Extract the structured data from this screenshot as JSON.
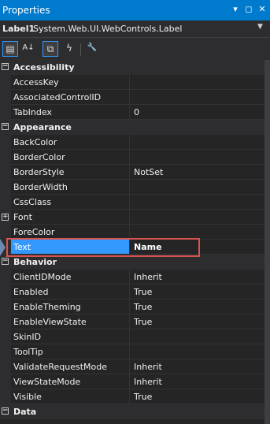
{
  "window": {
    "title": "Properties",
    "buttons": [
      "▾",
      "◻",
      "✕"
    ]
  },
  "object_selector": {
    "name": "Label1",
    "type": "System.Web.UI.WebControls.Label",
    "dropdown": "▼"
  },
  "toolbar": {
    "icons": [
      "categorized-icon",
      "alphabetical-icon",
      "properties-icon",
      "events-icon",
      "property-pages-icon"
    ],
    "glyphs": [
      "▤",
      "A↓",
      "⧉",
      "ϟ",
      "🔧"
    ]
  },
  "categories": [
    {
      "name": "Accessibility",
      "properties": [
        {
          "name": "AccessKey",
          "value": ""
        },
        {
          "name": "AssociatedControlID",
          "value": ""
        },
        {
          "name": "TabIndex",
          "value": "0"
        }
      ]
    },
    {
      "name": "Appearance",
      "properties": [
        {
          "name": "BackColor",
          "value": ""
        },
        {
          "name": "BorderColor",
          "value": ""
        },
        {
          "name": "BorderStyle",
          "value": "NotSet"
        },
        {
          "name": "BorderWidth",
          "value": ""
        },
        {
          "name": "CssClass",
          "value": ""
        },
        {
          "name": "Font",
          "value": ""
        },
        {
          "name": "ForeColor",
          "value": ""
        },
        {
          "name": "Text",
          "value": "Name"
        }
      ]
    },
    {
      "name": "Behavior",
      "properties": [
        {
          "name": "ClientIDMode",
          "value": "Inherit"
        },
        {
          "name": "Enabled",
          "value": "True"
        },
        {
          "name": "EnableTheming",
          "value": "True"
        },
        {
          "name": "EnableViewState",
          "value": "True"
        },
        {
          "name": "SkinID",
          "value": ""
        },
        {
          "name": "ToolTip",
          "value": ""
        },
        {
          "name": "ValidateRequestMode",
          "value": "Inherit"
        },
        {
          "name": "ViewStateMode",
          "value": "Inherit"
        },
        {
          "name": "Visible",
          "value": "True"
        }
      ]
    },
    {
      "name": "Data",
      "properties": []
    }
  ],
  "selected_property": "Text",
  "expandable_property": "Font",
  "colors": {
    "accent": "#007acc",
    "selection": "#3399ff",
    "highlight_box": "#d9534f",
    "background": "#252526"
  }
}
